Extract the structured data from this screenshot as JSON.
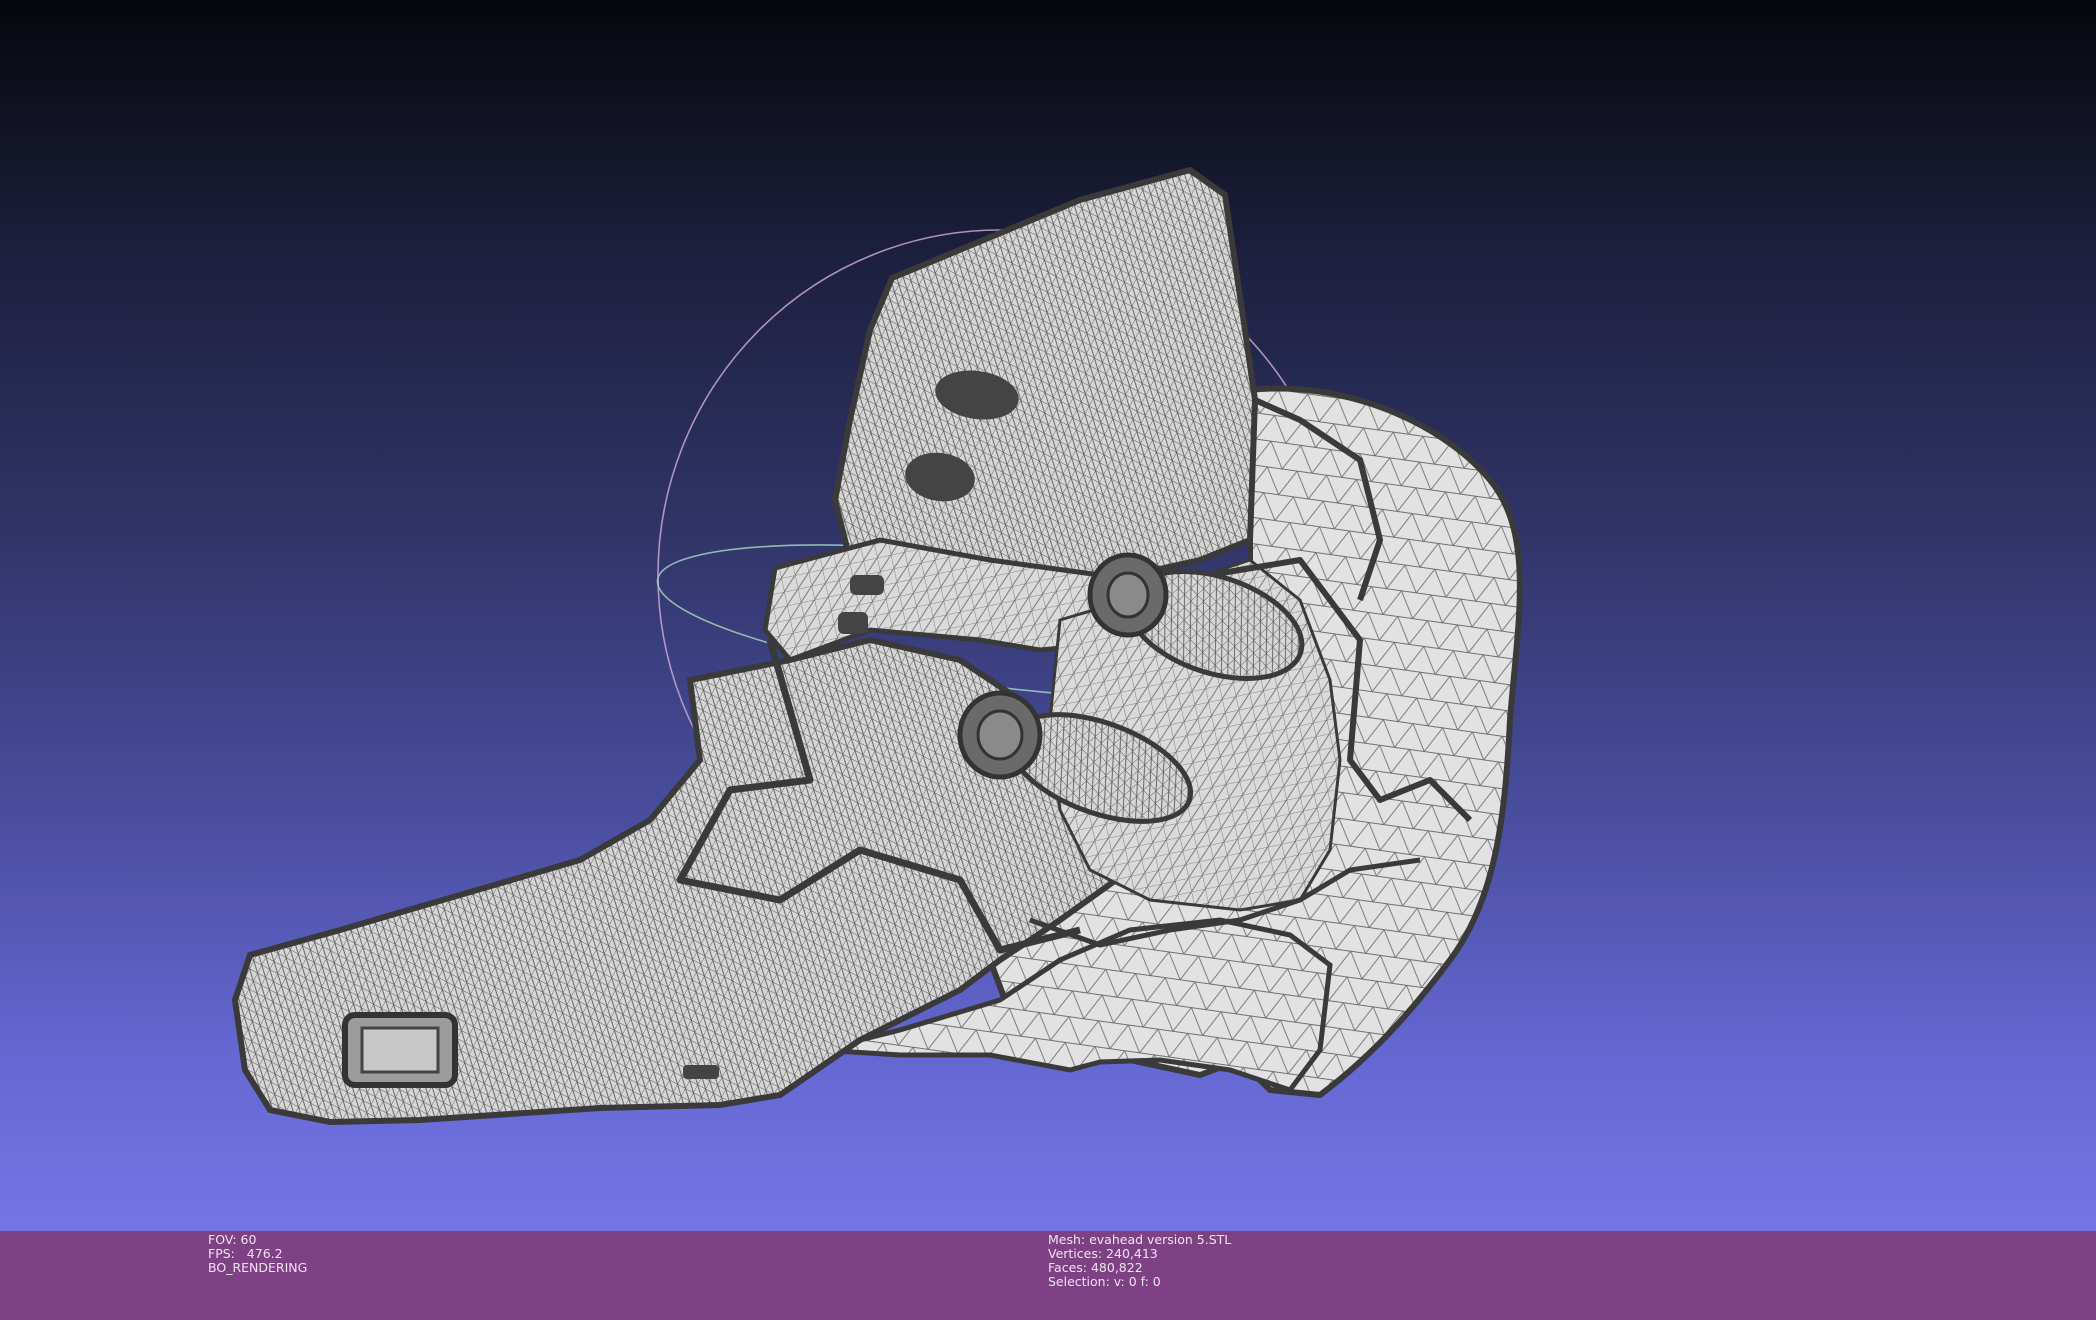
{
  "viewport": {
    "label": "3D mesh viewport",
    "background_top": "#06070c",
    "background_bottom": "#7476e6"
  },
  "mesh": {
    "fill_color": "#d9d9d9",
    "wire_color": "#3d3d3d",
    "trackball_color": "#c9a5d3"
  },
  "status": {
    "fov": "FOV: 60",
    "fps": "FPS:   476.2",
    "mode": "BO_RENDERING",
    "mesh_name": "Mesh: evahead version 5.STL",
    "vertices": "Vertices: 240,413",
    "faces": "Faces: 480,822",
    "selection": "Selection: v: 0 f: 0"
  },
  "colors": {
    "statusbar_bg": "#7e4284",
    "statusbar_text": "#f1e3f2"
  }
}
